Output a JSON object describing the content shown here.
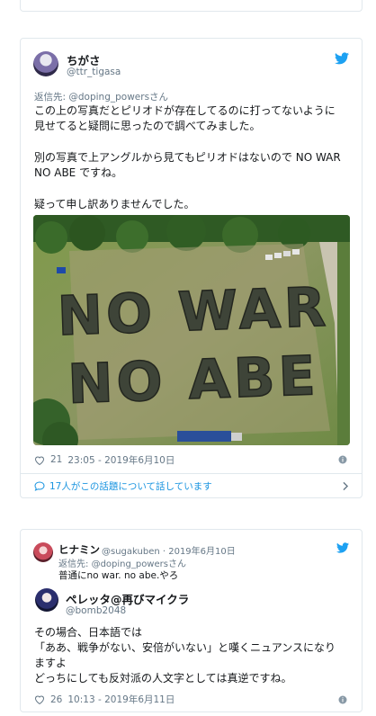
{
  "colors": {
    "brand": "#1da1f2",
    "link": "#1b95e0",
    "muted": "#657786",
    "text": "#14171a",
    "border": "#e1e8ed"
  },
  "tweet1": {
    "display_name": "ちがさ",
    "screen_name": "@ttr_tigasa",
    "reply_prefix": "返信先: ",
    "reply_mention": "@doping_powersさん",
    "text_lines": [
      "この上の写真だとピリオドが存在してるのに打ってないように",
      "見せてると疑問に思ったので調べてみました。",
      "別の写真で上アングルから見てもピリオドはないので NO WAR",
      "NO ABE ですね。",
      "疑って申し訳ありませんでした。"
    ],
    "photo_text_line1": "NO WAR",
    "photo_text_line2": "NO ABE",
    "likes": "21",
    "timestamp": "23:05 - 2019年6月10日",
    "conversation": "17人がこの話題について話しています",
    "icons": [
      "twitter-bird-icon",
      "heart-icon",
      "info-icon",
      "chat-bubble-icon",
      "chevron-right-icon"
    ]
  },
  "tweet2": {
    "display_name": "ヒナミン",
    "screen_name_date": "@sugakuben · 2019年6月10日",
    "reply_prefix": "返信先: ",
    "reply_mention": "@doping_powersさん",
    "quoted_text": "普通にno war.  no abe.やろ",
    "author_name": "ペレッタ@再びマイクラ",
    "author_handle": "@bomb2048",
    "text_lines": [
      "その場合、日本語では",
      "「ああ、戦争がない、安倍がいない」と嘆くニュアンスになり",
      "ますよ",
      "どっちにしても反対派の人文字としては真逆ですね。"
    ],
    "likes": "26",
    "timestamp": "10:13 - 2019年6月11日",
    "icons": [
      "twitter-bird-icon",
      "heart-icon",
      "info-icon"
    ]
  }
}
